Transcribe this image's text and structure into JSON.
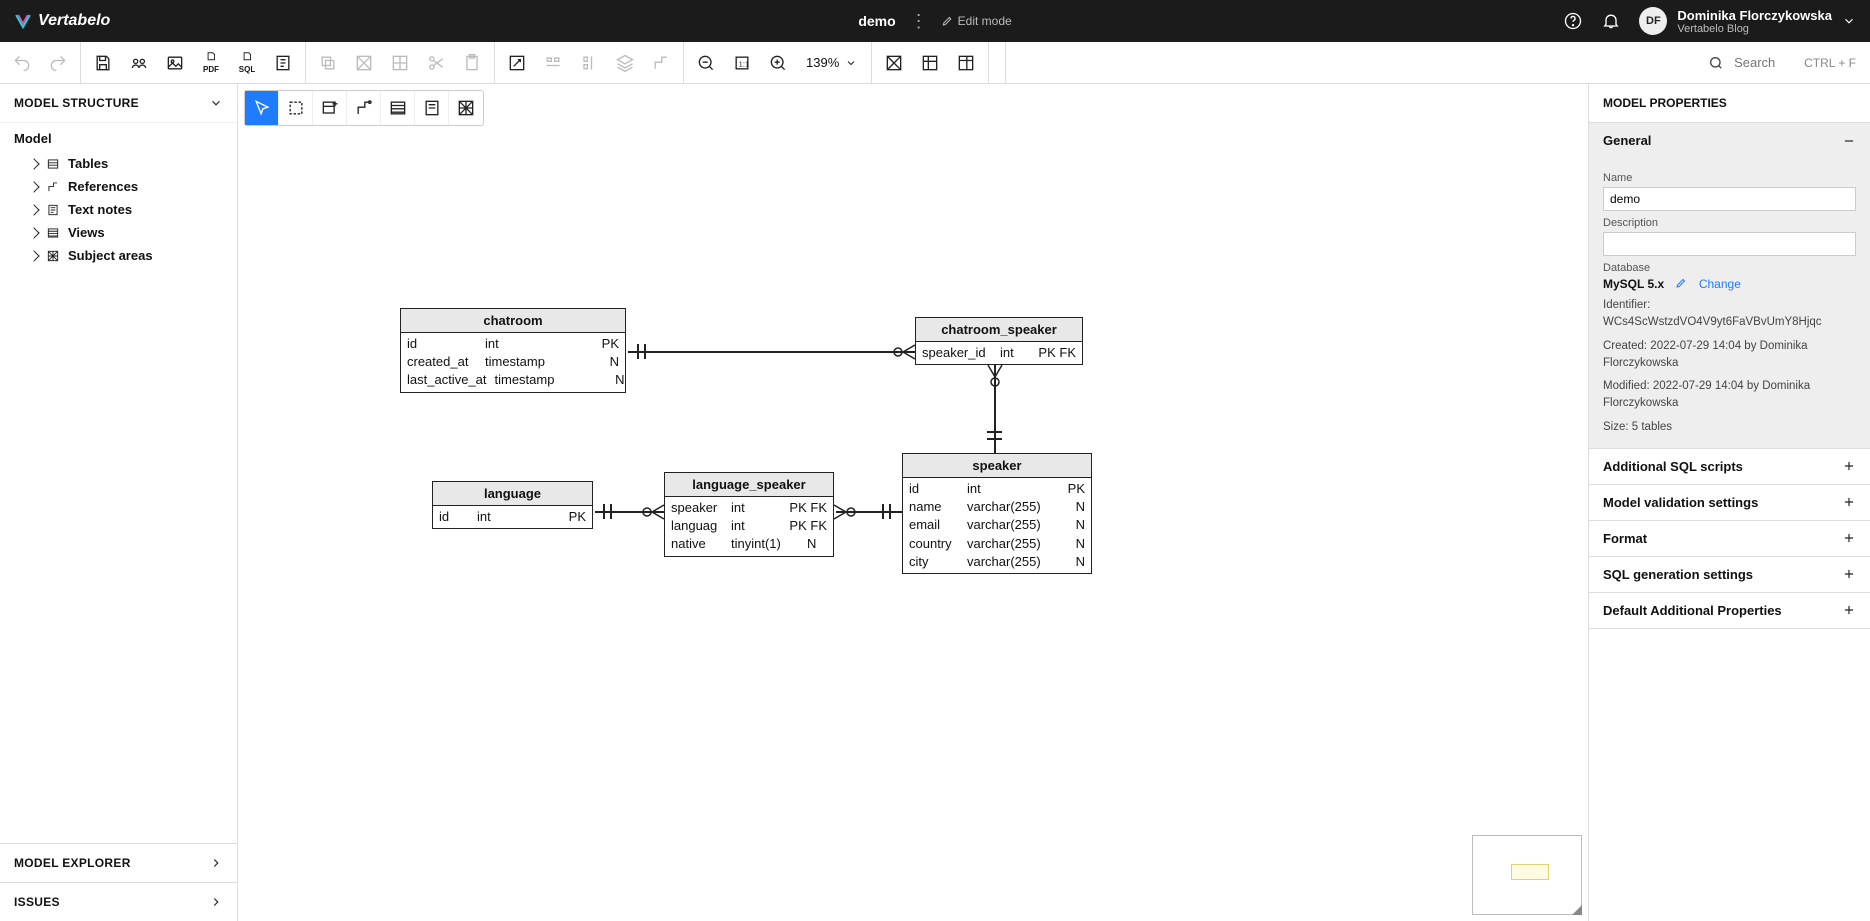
{
  "brand": "Vertabelo",
  "model_title": "demo",
  "edit_mode": "Edit mode",
  "user": {
    "initials": "DF",
    "name": "Dominika Florczykowska",
    "sub": "Vertabelo Blog"
  },
  "search": {
    "placeholder": "Search",
    "hint": "CTRL + F"
  },
  "zoom": "139%",
  "left": {
    "header": "MODEL STRUCTURE",
    "root": "Model",
    "items": [
      "Tables",
      "References",
      "Text notes",
      "Views",
      "Subject areas"
    ],
    "explorer": "MODEL EXPLORER",
    "issues": "ISSUES"
  },
  "right": {
    "header": "MODEL PROPERTIES",
    "general": {
      "title": "General",
      "name_label": "Name",
      "name_value": "demo",
      "desc_label": "Description",
      "desc_value": "",
      "db_label": "Database",
      "db_value": "MySQL 5.x",
      "change": "Change",
      "identifier": "Identifier: WCs4ScWstzdVO4V9yt6FaVBvUmY8Hjqc",
      "created": "Created: 2022-07-29 14:04 by Dominika Florczykowska",
      "modified": "Modified: 2022-07-29 14:04 by Dominika Florczykowska",
      "size": "Size: 5 tables"
    },
    "sections": [
      "Additional SQL scripts",
      "Model validation settings",
      "Format",
      "SQL generation settings",
      "Default Additional Properties"
    ]
  },
  "erd": {
    "chatroom": {
      "title": "chatroom",
      "cols": [
        {
          "n": "id",
          "t": "int",
          "k": "PK"
        },
        {
          "n": "created_at",
          "t": "timestamp",
          "k": "N"
        },
        {
          "n": "last_active_at",
          "t": "timestamp",
          "k": "N"
        }
      ]
    },
    "chatroom_speaker": {
      "title": "chatroom_speaker",
      "cols": [
        {
          "n": "speaker_id",
          "t": "int",
          "k": "PK FK"
        }
      ]
    },
    "language": {
      "title": "language",
      "cols": [
        {
          "n": "id",
          "t": "int",
          "k": "PK"
        }
      ]
    },
    "language_speaker": {
      "title": "language_speaker",
      "cols": [
        {
          "n": "speaker",
          "t": "int",
          "k": "PK FK"
        },
        {
          "n": "languag",
          "t": "int",
          "k": "PK FK"
        },
        {
          "n": "native",
          "t": "tinyint(1)",
          "k": "N"
        }
      ]
    },
    "speaker": {
      "title": "speaker",
      "cols": [
        {
          "n": "id",
          "t": "int",
          "k": "PK"
        },
        {
          "n": "name",
          "t": "varchar(255)",
          "k": "N"
        },
        {
          "n": "email",
          "t": "varchar(255)",
          "k": "N"
        },
        {
          "n": "country",
          "t": "varchar(255)",
          "k": "N"
        },
        {
          "n": "city",
          "t": "varchar(255)",
          "k": "N"
        }
      ]
    }
  }
}
